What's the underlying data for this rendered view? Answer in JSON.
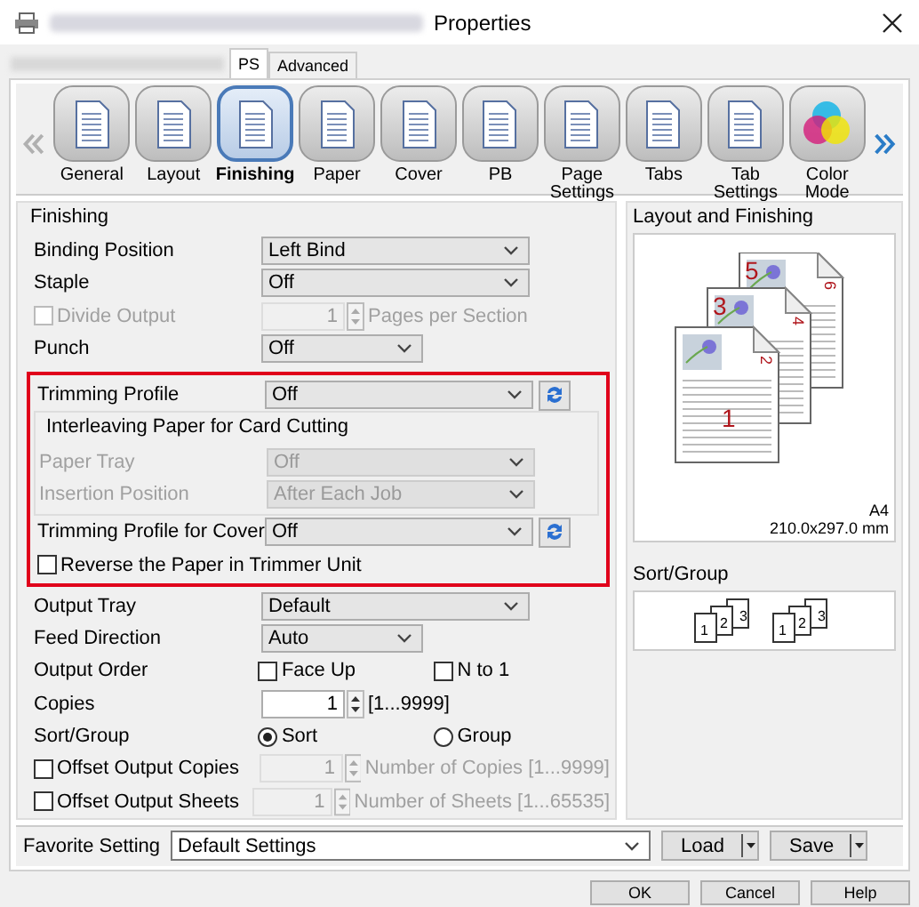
{
  "window": {
    "title": "Properties"
  },
  "tabs": [
    {
      "label": "PS",
      "selected": true
    },
    {
      "label": "Advanced",
      "selected": false
    }
  ],
  "categories": [
    {
      "label": "General",
      "selected": false
    },
    {
      "label": "Layout",
      "selected": false
    },
    {
      "label": "Finishing",
      "selected": true
    },
    {
      "label": "Paper",
      "selected": false
    },
    {
      "label": "Cover",
      "selected": false
    },
    {
      "label": "PB",
      "selected": false
    },
    {
      "label": "Page Settings",
      "selected": false
    },
    {
      "label": "Tabs",
      "selected": false
    },
    {
      "label": "Tab Settings",
      "selected": false
    },
    {
      "label": "Color Mode",
      "selected": false
    }
  ],
  "finishing": {
    "title": "Finishing",
    "rows": [
      {
        "kind": "select",
        "label": "Binding Position",
        "value": "Left Bind"
      },
      {
        "kind": "select",
        "label": "Staple",
        "value": "Off"
      },
      {
        "kind": "check-spin",
        "label": "Divide Output",
        "checked": false,
        "disabled": true,
        "value": "1",
        "unit": "Pages per Section"
      },
      {
        "kind": "select-short",
        "label": "Punch",
        "value": "Off"
      }
    ],
    "trimming": {
      "profile": {
        "label": "Trimming Profile",
        "value": "Off"
      },
      "interleaving": {
        "title": "Interleaving Paper for Card Cutting",
        "rows": [
          {
            "label": "Paper Tray",
            "value": "Off",
            "disabled": true
          },
          {
            "label": "Insertion Position",
            "value": "After Each Job",
            "disabled": true
          }
        ]
      },
      "cover_profile": {
        "label": "Trimming Profile for Cover",
        "value": "Off"
      },
      "reverse": {
        "label": "Reverse the Paper in Trimmer Unit",
        "checked": false
      }
    },
    "rows_after": [
      {
        "kind": "select",
        "label": "Output Tray",
        "value": "Default"
      },
      {
        "kind": "select-short",
        "label": "Feed Direction",
        "value": "Auto"
      },
      {
        "kind": "checks",
        "label": "Output Order",
        "options": [
          {
            "label": "Face Up",
            "checked": false
          },
          {
            "label": "N to 1",
            "checked": false
          }
        ]
      },
      {
        "kind": "spin",
        "label": "Copies",
        "value": "1",
        "unit": "[1...9999]"
      },
      {
        "kind": "radios",
        "label": "Sort/Group",
        "options": [
          {
            "label": "Sort",
            "selected": true
          },
          {
            "label": "Group",
            "selected": false
          }
        ]
      },
      {
        "kind": "check-spin",
        "label": "Offset Output Copies",
        "checked": false,
        "disabled": false,
        "value": "1",
        "unit": "Number of Copies [1...9999]"
      },
      {
        "kind": "check-spin",
        "label": "Offset Output Sheets",
        "checked": false,
        "disabled": false,
        "value": "1",
        "unit": "Number of Sheets [1...65535]"
      }
    ]
  },
  "preview": {
    "title": "Layout and Finishing",
    "page_numbers": [
      "1",
      "2",
      "3",
      "4",
      "5",
      "6"
    ],
    "paper_size": "A4",
    "dimensions": "210.0x297.0 mm"
  },
  "sort_group": {
    "title": "Sort/Group",
    "sets": [
      [
        "1",
        "2",
        "3"
      ],
      [
        "1",
        "2",
        "3"
      ]
    ]
  },
  "favorite": {
    "label": "Favorite Setting",
    "value": "Default Settings",
    "buttons": [
      "Load",
      "Save"
    ]
  },
  "buttons": [
    "OK",
    "Cancel",
    "Help"
  ]
}
